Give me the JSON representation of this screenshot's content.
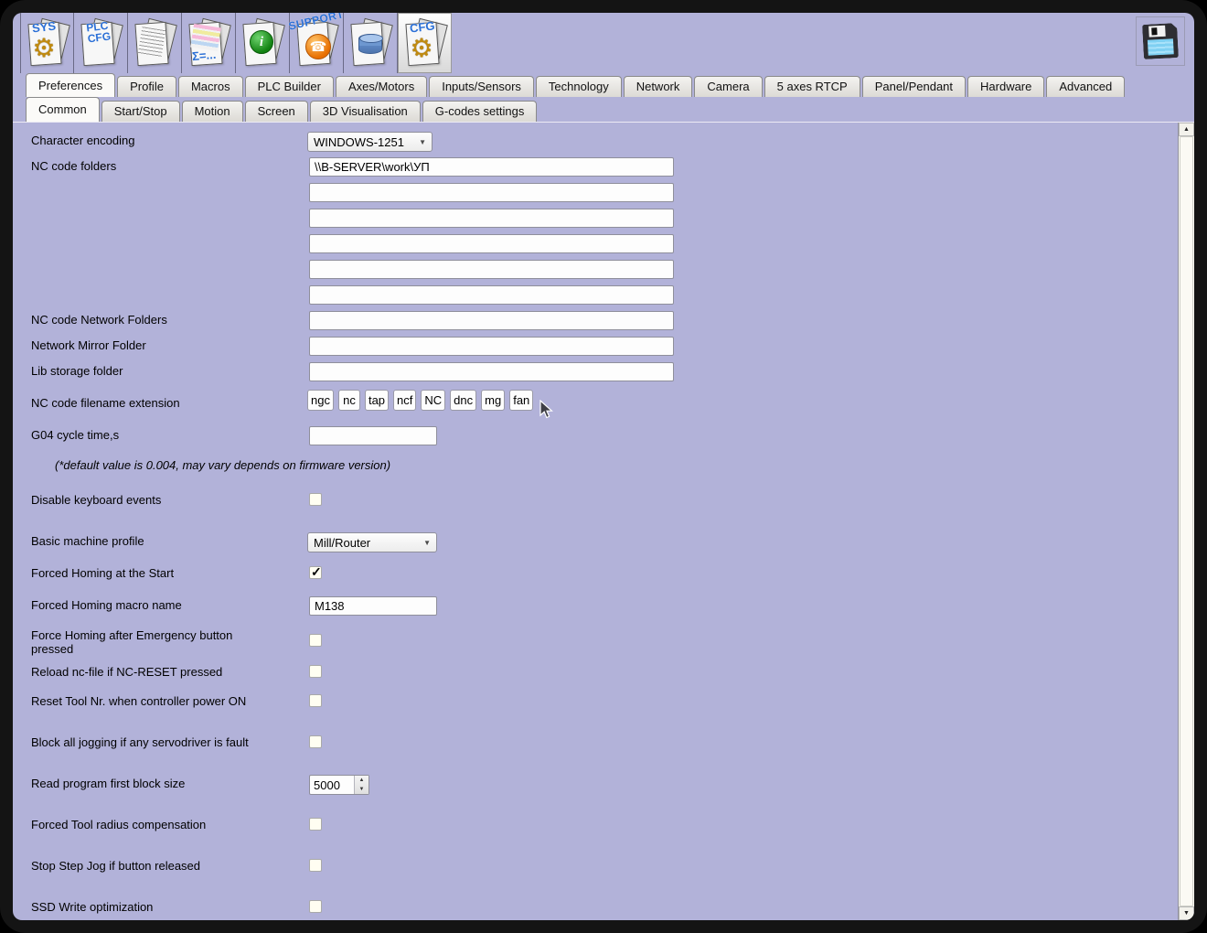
{
  "colors": {
    "bg": "#b2b2d9",
    "frame": "#141414",
    "accent_blue": "#2a6fd6"
  },
  "icons": {
    "dropdown_arrow": "▼",
    "spin_up": "▲",
    "spin_down": "▼",
    "scroll_up": "▲",
    "scroll_down": "▼",
    "checkmark": "✓",
    "gear": "⚙",
    "phone": "☎",
    "info_glyph": "i"
  },
  "toolbar": {
    "sys_label": "SYS",
    "plc_line1": "PLC",
    "plc_line2": "CFG",
    "sigma_label": "Σ=...",
    "support_label": "SUPPORT",
    "cfg_label": "CFG"
  },
  "primary_tabs": {
    "selected": "Preferences",
    "items": [
      "Preferences",
      "Profile",
      "Macros",
      "PLC Builder",
      "Axes/Motors",
      "Inputs/Sensors",
      "Technology",
      "Network",
      "Camera",
      "5 axes RTCP",
      "Panel/Pendant",
      "Hardware",
      "Advanced"
    ]
  },
  "secondary_tabs": {
    "selected": "Common",
    "items": [
      "Common",
      "Start/Stop",
      "Motion",
      "Screen",
      "3D Visualisation",
      "G-codes settings"
    ]
  },
  "form": {
    "character_encoding": {
      "label": "Character encoding",
      "value": "WINDOWS-1251"
    },
    "nc_code_folders": {
      "label": "NC code folders",
      "value": "\\\\B-SERVER\\work\\УП",
      "empty_count": 5
    },
    "nc_network_folders": {
      "label": "NC code Network Folders",
      "value": ""
    },
    "network_mirror_folder": {
      "label": "Network Mirror Folder",
      "value": ""
    },
    "lib_storage_folder": {
      "label": "Lib storage folder",
      "value": ""
    },
    "nc_extensions": {
      "label": "NC code filename extension",
      "values": [
        "ngc",
        "nc",
        "tap",
        "ncf",
        "NC",
        "dnc",
        "mg",
        "fan"
      ]
    },
    "g04_cycle_time": {
      "label": "G04 cycle time,s",
      "value": ""
    },
    "g04_note": "(*default value is 0.004, may vary depends on firmware version)",
    "disable_keyboard": {
      "label": "Disable keyboard events",
      "checked": false
    },
    "basic_profile": {
      "label": "Basic machine profile",
      "value": "Mill/Router"
    },
    "forced_homing_start": {
      "label": "Forced Homing at the Start",
      "checked": true
    },
    "forced_homing_macro": {
      "label": "Forced Homing macro name",
      "value": "M138"
    },
    "force_homing_emergency": {
      "label": "Force Homing after Emergency button pressed",
      "checked": false
    },
    "reload_ncfile": {
      "label": "Reload nc-file if NC-RESET pressed",
      "checked": false
    },
    "reset_tool_nr": {
      "label": "Reset Tool Nr. when controller power ON",
      "checked": false
    },
    "block_jogging": {
      "label": "Block all jogging if any servodriver is fault",
      "checked": false
    },
    "read_block_size": {
      "label": "Read program first block size",
      "value": "5000"
    },
    "forced_tool_radius": {
      "label": "Forced Tool radius compensation",
      "checked": false
    },
    "stop_step_jog": {
      "label": "Stop Step Jog if button released",
      "checked": false
    },
    "ssd_write": {
      "label": "SSD Write optimization",
      "checked": false
    }
  }
}
